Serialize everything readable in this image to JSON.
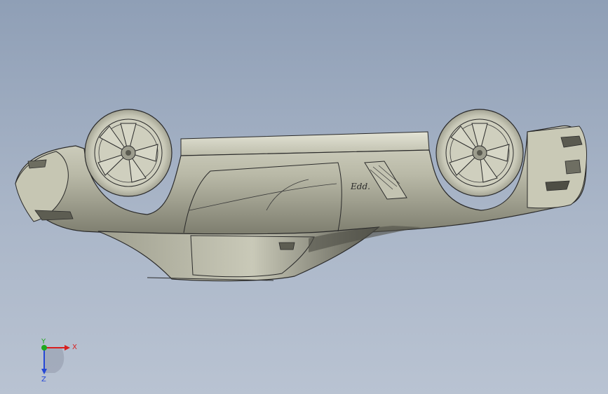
{
  "viewport": {
    "background_top": "#8f9fb6",
    "background_bottom": "#b9c3d2"
  },
  "model": {
    "body_color": "#b8b8a6",
    "outline_color": "#2a2a2a",
    "badge_text": "Edd."
  },
  "triad": {
    "x_label": "X",
    "y_label": "Y",
    "z_label": "Z",
    "x_color": "#d81f1f",
    "y_color": "#1fa81f",
    "z_color": "#2547d6"
  }
}
